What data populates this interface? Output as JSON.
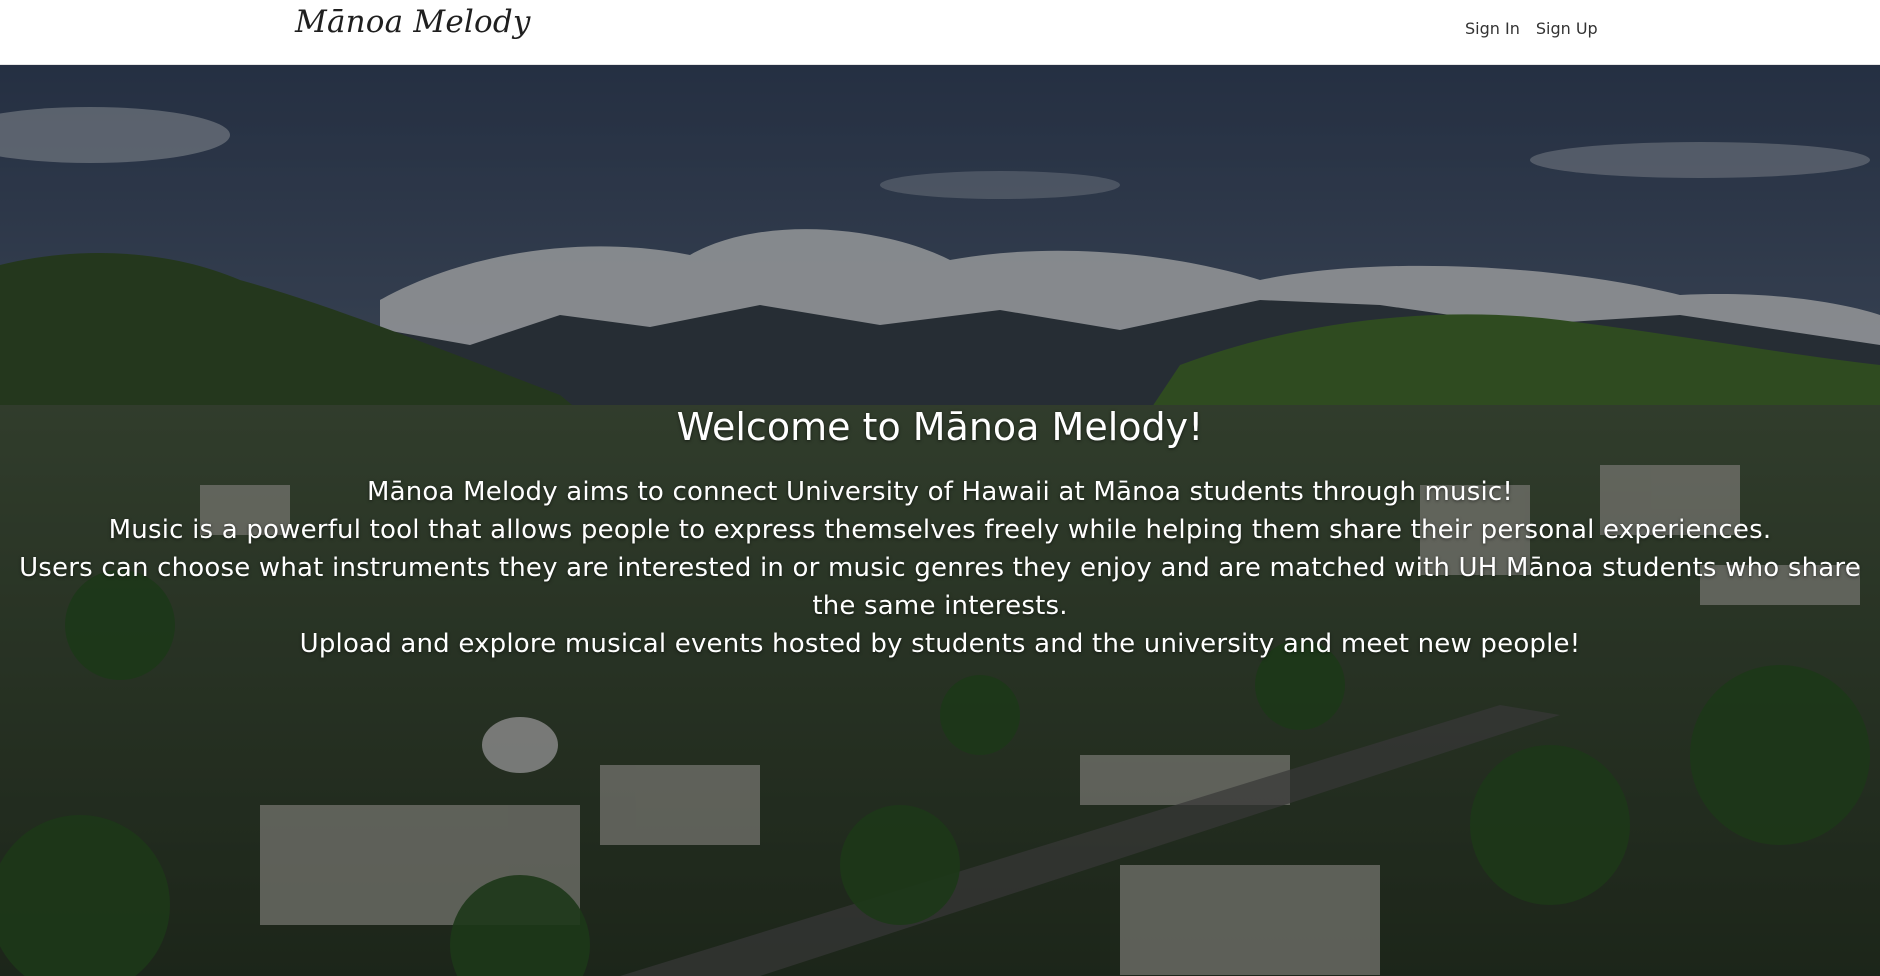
{
  "navbar": {
    "brand": "Mānoa Melody",
    "links": [
      "Sign In",
      "Sign Up"
    ]
  },
  "hero": {
    "title": "Welcome to Mānoa Melody!",
    "lines": [
      "Mānoa Melody aims to connect University of Hawaii at Mānoa students through music!",
      "Music is a powerful tool that allows people to express themselves freely while helping them share their personal experiences.",
      "Users can choose what instruments they are interested in or music genres they enjoy and are matched with UH Mānoa students who share the same interests.",
      "Upload and explore musical events hosted by students and the university and meet new people!"
    ]
  },
  "colors": {
    "navbar_bg": "#ffffff",
    "hero_text": "#ffffff",
    "sky": "#4a5a72",
    "mountains": "#2f4a2c",
    "town": "#5d6a58"
  }
}
